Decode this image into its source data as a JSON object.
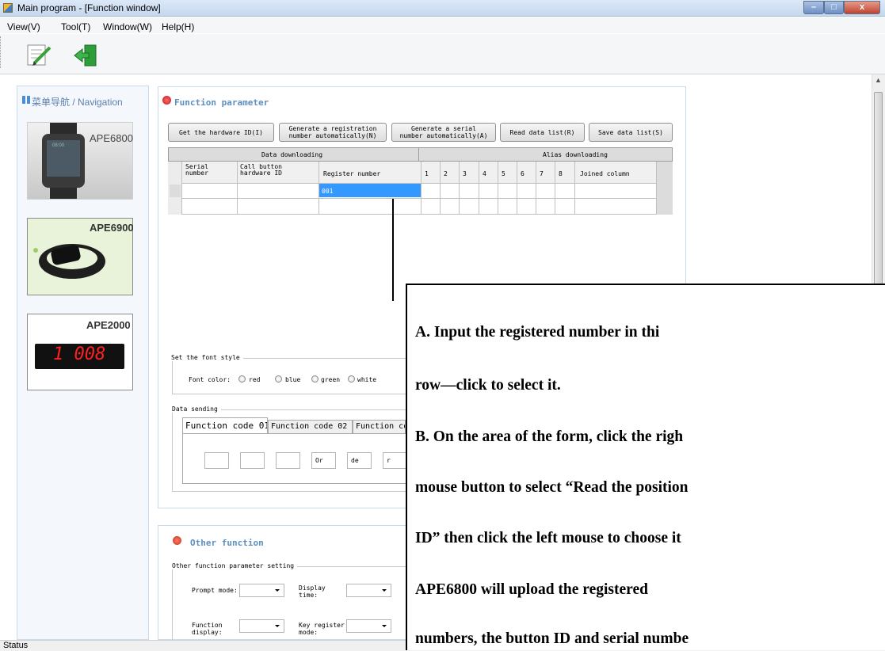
{
  "window": {
    "title": "Main program - [Function window]",
    "minimize_label": "–",
    "maximize_label": "□",
    "close_label": "x"
  },
  "menu": [
    "View(V)",
    "Tool(T)",
    "Window(W)",
    "Help(H)"
  ],
  "toolbar": {
    "icons": [
      "edit-icon",
      "exit-icon"
    ]
  },
  "nav": {
    "title": "菜单导航 / Navigation",
    "products": [
      {
        "label": "APE6800",
        "screen_text": "08:00"
      },
      {
        "label": "APE6900"
      },
      {
        "label": "APE2000",
        "display": "1 008"
      }
    ]
  },
  "function_panel": {
    "title": "Function parameter",
    "buttons": [
      "Get the hardware ID(I)",
      "Generate a registration\nnumber automatically(N)",
      "Generate a serial\nnumber automatically(A)",
      "Read data list(R)",
      "Save data list(S)"
    ],
    "group_headers": [
      "Data downloading",
      "Alias downloading"
    ],
    "columns": [
      "Serial\nnumber",
      "Call button\nhardware ID",
      "Register number",
      "1",
      "2",
      "3",
      "4",
      "5",
      "6",
      "7",
      "8",
      "Joined column"
    ],
    "rows": [
      {
        "serial": "",
        "hardware_id": "",
        "register": "001"
      },
      {
        "serial": "",
        "hardware_id": "",
        "register": ""
      }
    ],
    "font_style": {
      "legend": "Set the font style",
      "label": "Font color:",
      "options": [
        "red",
        "blue",
        "green",
        "white"
      ]
    },
    "data_sending": {
      "legend": "Data sending",
      "tabs": [
        "Function code 01",
        "Function code 02",
        "Function co"
      ],
      "fields": [
        "",
        "",
        "",
        "Or",
        "de",
        "r"
      ]
    }
  },
  "other_panel": {
    "title": "Other function",
    "legend": "Other function parameter setting",
    "fields": [
      {
        "label": "Prompt mode:",
        "value": ""
      },
      {
        "label": "Display\ntime:",
        "value": ""
      },
      {
        "label": "Function\ndisplay:",
        "value": ""
      },
      {
        "label": "Key register\nmode:",
        "value": ""
      }
    ]
  },
  "status": {
    "text": "Status"
  },
  "callout": {
    "lines": [
      "A.  Input  the  registered  number  in  thi",
      "row—click to select it.",
      "B. On the area of the form, click the righ",
      "mouse button to select “Read the position",
      "ID” then click the left mouse to choose it",
      "APE6800      will      upload      the      registered",
      "numbers, the button ID and serial numbe"
    ]
  },
  "colors": {
    "accent_blue": "#5b8fc0",
    "selected_cell": "#3399ff",
    "nav_bg": "#f4f8fc",
    "panel_border": "#c9dced"
  }
}
